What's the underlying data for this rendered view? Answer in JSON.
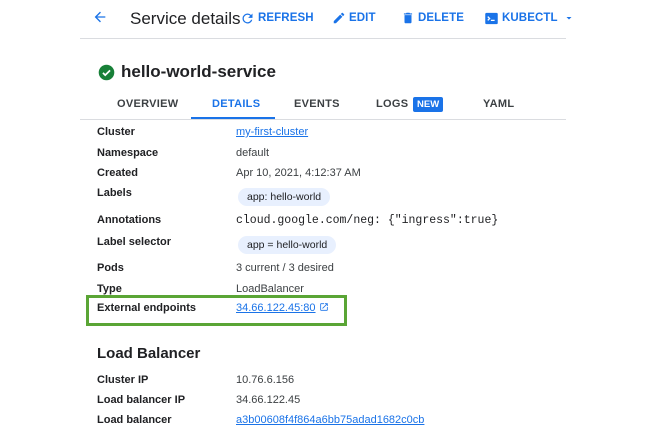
{
  "toolbar": {
    "title": "Service details",
    "refresh_label": "REFRESH",
    "edit_label": "EDIT",
    "delete_label": "DELETE",
    "kubectl_label": "KUBECTL"
  },
  "service": {
    "name": "hello-world-service",
    "status": "ok"
  },
  "tabs": [
    {
      "label": "OVERVIEW",
      "active": false
    },
    {
      "label": "DETAILS",
      "active": true
    },
    {
      "label": "EVENTS",
      "active": false
    },
    {
      "label": "LOGS",
      "active": false,
      "badge": "NEW"
    },
    {
      "label": "YAML",
      "active": false
    }
  ],
  "details": {
    "cluster": {
      "label": "Cluster",
      "value": "my-first-cluster"
    },
    "namespace": {
      "label": "Namespace",
      "value": "default"
    },
    "created": {
      "label": "Created",
      "value": "Apr 10, 2021, 4:12:37 AM"
    },
    "labels": {
      "label": "Labels",
      "value": "app: hello-world"
    },
    "annotations": {
      "label": "Annotations",
      "value": "cloud.google.com/neg: {\"ingress\":true}"
    },
    "label_selector": {
      "label": "Label selector",
      "value": "app = hello-world"
    },
    "pods": {
      "label": "Pods",
      "value": "3 current / 3 desired"
    },
    "type": {
      "label": "Type",
      "value": "LoadBalancer"
    },
    "external_endpoints": {
      "label": "External endpoints",
      "value": "34.66.122.45:80"
    }
  },
  "load_balancer": {
    "title": "Load Balancer",
    "cluster_ip": {
      "label": "Cluster IP",
      "value": "10.76.6.156"
    },
    "lb_ip": {
      "label": "Load balancer IP",
      "value": "34.66.122.45"
    },
    "lb": {
      "label": "Load balancer",
      "value": "a3b00608f4f864a6bb75adad1682c0cb"
    }
  },
  "colors": {
    "accent": "#1a73e8",
    "highlight": "#5aa535",
    "status_ok": "#188038",
    "chip_bg": "#e8f0fe"
  }
}
